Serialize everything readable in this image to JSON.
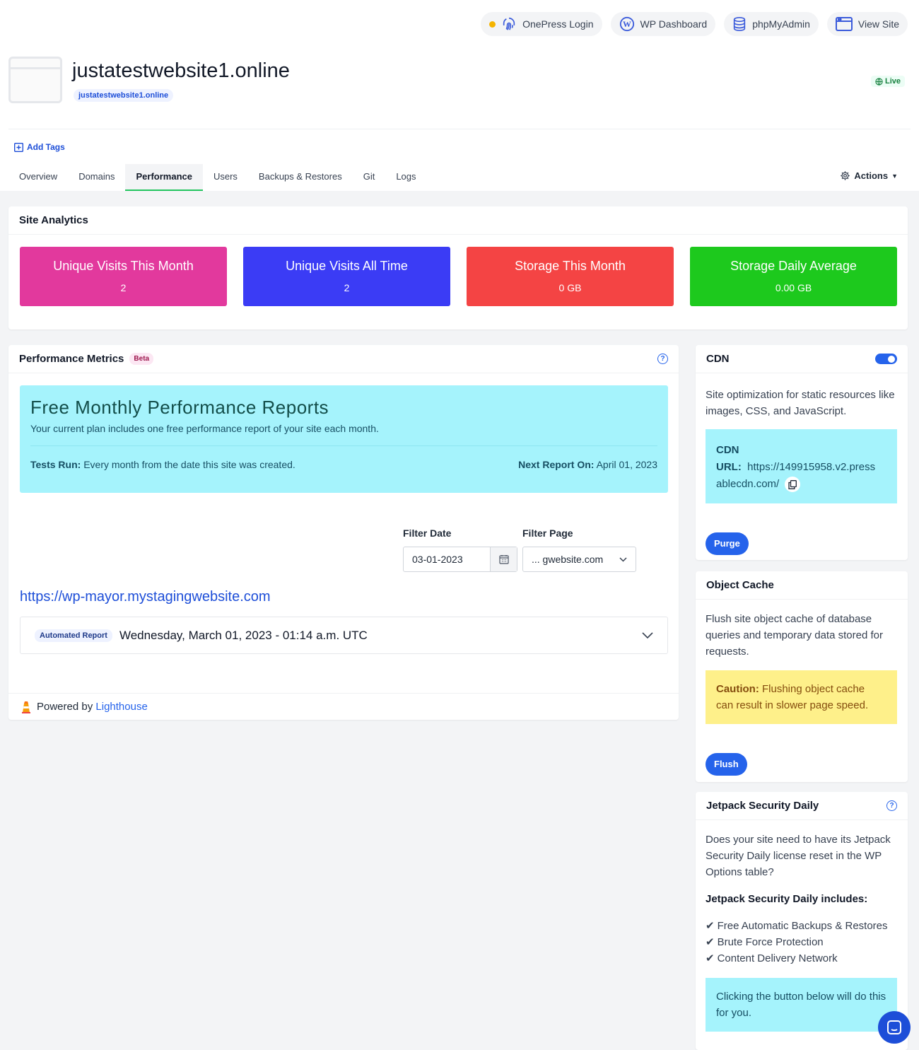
{
  "toplinks": [
    "OnePress Login",
    "WP Dashboard",
    "phpMyAdmin",
    "View Site"
  ],
  "site": {
    "title": "justatestwebsite1.online",
    "domain": "justatestwebsite1.online",
    "status": "Live"
  },
  "add_tags": "Add Tags",
  "tabs": [
    "Overview",
    "Domains",
    "Performance",
    "Users",
    "Backups & Restores",
    "Git",
    "Logs"
  ],
  "actions": "Actions",
  "analytics": {
    "title": "Site Analytics",
    "stats": [
      {
        "label": "Unique Visits This Month",
        "value": "2",
        "color": "#e2399d"
      },
      {
        "label": "Unique Visits All Time",
        "value": "2",
        "color": "#3b3cf5"
      },
      {
        "label": "Storage This Month",
        "value": "0 GB",
        "color": "#f44444"
      },
      {
        "label": "Storage Daily Average",
        "value": "0.00 GB",
        "color": "#1dc91d"
      }
    ]
  },
  "perf": {
    "title": "Performance Metrics",
    "badge": "Beta",
    "banner_title": "Free Monthly Performance Reports",
    "banner_text": "Your current plan includes one free performance report of your site each month.",
    "tests_label": "Tests Run:",
    "tests_value": "Every month from the date this site was created.",
    "next_label": "Next Report On:",
    "next_value": "April 01, 2023",
    "filter_date_label": "Filter Date",
    "filter_date_value": "03-01-2023",
    "filter_page_label": "Filter Page",
    "filter_page_value": "... gwebsite.com",
    "site_url": "https://wp-mayor.mystagingwebsite.com",
    "report_badge": "Automated Report",
    "report_text": "Wednesday, March 01, 2023 - 01:14 a.m. UTC",
    "powered_by": "Powered by",
    "powered_link": "Lighthouse"
  },
  "cdn": {
    "title": "CDN",
    "enabled": true,
    "desc": "Site optimization for static resources like images, CSS, and JavaScript.",
    "box_title": "CDN",
    "url_label": "URL:",
    "url_line1": "https://149915958.v2.press",
    "url_line2": "ablecdn.com/",
    "button": "Purge"
  },
  "object_cache": {
    "title": "Object Cache",
    "desc": "Flush site object cache of database queries and temporary data stored for requests.",
    "caution_label": "Caution:",
    "caution_line1": "Flushing object cache",
    "caution_line2": "can result in slower page speed.",
    "button": "Flush"
  },
  "jetpack": {
    "title": "Jetpack Security Daily",
    "desc": "Does your site need to have its Jetpack Security Daily license reset in the WP Options table?",
    "includes_title": "Jetpack Security Daily includes:",
    "includes": [
      "Free Automatic Backups & Restores",
      "Brute Force Protection",
      "Content Delivery Network"
    ],
    "info": "Clicking the button below will do this for you."
  }
}
